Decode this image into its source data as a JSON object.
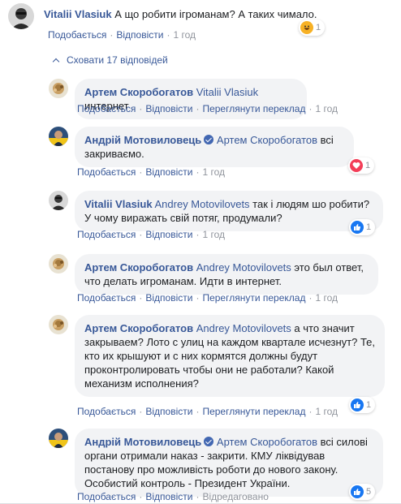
{
  "top_comment": {
    "author": "Vitalii Vlasiuk",
    "text": "А що робити ігроманам? А таких чимало.",
    "actions": {
      "like": "Подобається",
      "reply": "Відповісти",
      "time": "1 год"
    },
    "reaction": {
      "icon": "haha-icon",
      "count": "1"
    }
  },
  "hide_replies_label": "Сховати 17 відповідей",
  "replies": [
    {
      "author": "Артем Скоробогатов",
      "mention": "Vitalii Vlasiuk",
      "text": " интернет",
      "actions": {
        "like": "Подобається",
        "reply": "Відповісти",
        "translate": "Переглянути переклад",
        "time": "1 год"
      }
    },
    {
      "author": "Андрій Мотовиловець",
      "verified": true,
      "mention": "Артем Скоробогатов",
      "text": " всі закриваємо.",
      "actions": {
        "like": "Подобається",
        "reply": "Відповісти",
        "time": "1 год"
      },
      "reaction": {
        "icon": "love-icon",
        "count": "1"
      }
    },
    {
      "author": "Vitalii Vlasiuk",
      "mention": "Andrey Motovilovets",
      "text": " так і людям шо робити? У чому виражать свій потяг, продумали?",
      "actions": {
        "like": "Подобається",
        "reply": "Відповісти",
        "time": "1 год"
      },
      "reaction": {
        "icon": "like-icon",
        "count": "1"
      }
    },
    {
      "author": "Артем Скоробогатов",
      "mention": "Andrey Motovilovets",
      "text": " это был ответ, что делать игроманам. Идти в интернет.",
      "actions": {
        "like": "Подобається",
        "reply": "Відповісти",
        "translate": "Переглянути переклад",
        "time": "1 год"
      }
    },
    {
      "author": "Артем Скоробогатов",
      "mention": "Andrey Motovilovets",
      "text": " а что значит закрываем? Лото с улиц на каждом квартале исчезнут? Те, кто их крышуют и с них кормятся должны будут проконтролировать чтобы они не работали? Какой механизм исполнения?",
      "actions": {
        "like": "Подобається",
        "reply": "Відповісти",
        "translate": "Переглянути переклад",
        "time": "1 год"
      },
      "reaction": {
        "icon": "like-icon",
        "count": "1"
      }
    },
    {
      "author": "Андрій Мотовиловець",
      "verified": true,
      "mention": "Артем Скоробогатов",
      "text": " всі силові органи отримали наказ - закрити. КМУ ліквідував постанову про можливість роботи до нового закону. Особистий контроль - Президент України.",
      "actions": {
        "like": "Подобається",
        "reply": "Відповісти",
        "edited": "Відредаговано"
      },
      "reaction": {
        "icon": "like-icon",
        "count": "5"
      }
    }
  ]
}
